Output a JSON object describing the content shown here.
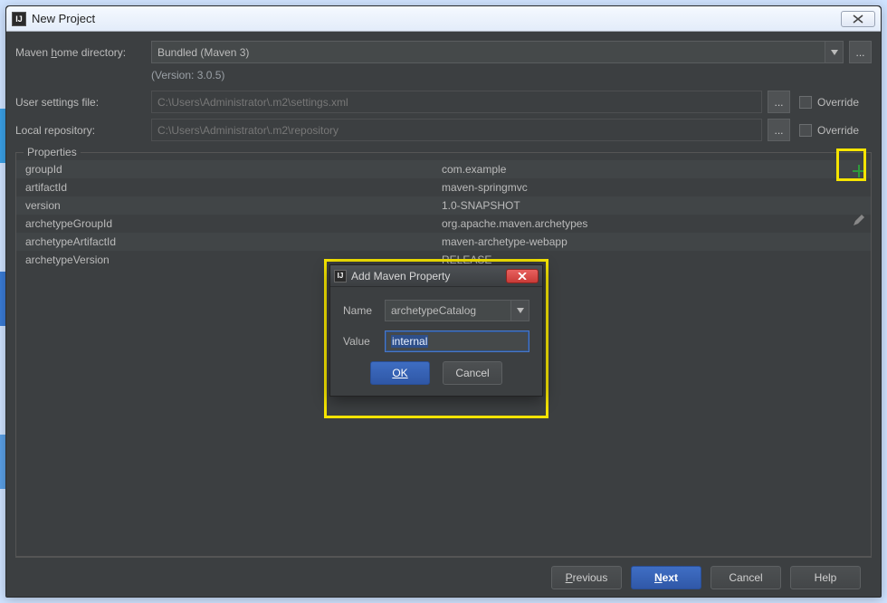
{
  "window": {
    "title": "New Project",
    "close_label": "✕"
  },
  "form": {
    "home_label_pre": "Maven ",
    "home_label_u": "h",
    "home_label_post": "ome directory:",
    "home_value": "Bundled (Maven 3)",
    "version_line": "(Version: 3.0.5)",
    "settings_label": "User settings file:",
    "settings_value": "C:\\Users\\Administrator\\.m2\\settings.xml",
    "repo_label": "Local repository:",
    "repo_value": "C:\\Users\\Administrator\\.m2\\repository",
    "override_label": "Override",
    "browse_label": "...",
    "properties_legend": "Properties",
    "properties": [
      {
        "key": "groupId",
        "value": "com.example"
      },
      {
        "key": "artifactId",
        "value": "maven-springmvc"
      },
      {
        "key": "version",
        "value": "1.0-SNAPSHOT"
      },
      {
        "key": "archetypeGroupId",
        "value": "org.apache.maven.archetypes"
      },
      {
        "key": "archetypeArtifactId",
        "value": "maven-archetype-webapp"
      },
      {
        "key": "archetypeVersion",
        "value": "RELEASE"
      }
    ]
  },
  "buttons": {
    "previous_u": "P",
    "previous_rest": "revious",
    "next_u": "N",
    "next_rest": "ext",
    "cancel": "Cancel",
    "help": "Help"
  },
  "dialog": {
    "title": "Add Maven Property",
    "name_label": "Name",
    "name_value": "archetypeCatalog",
    "value_label": "Value",
    "value_value": "internal",
    "ok": "OK",
    "cancel": "Cancel"
  }
}
